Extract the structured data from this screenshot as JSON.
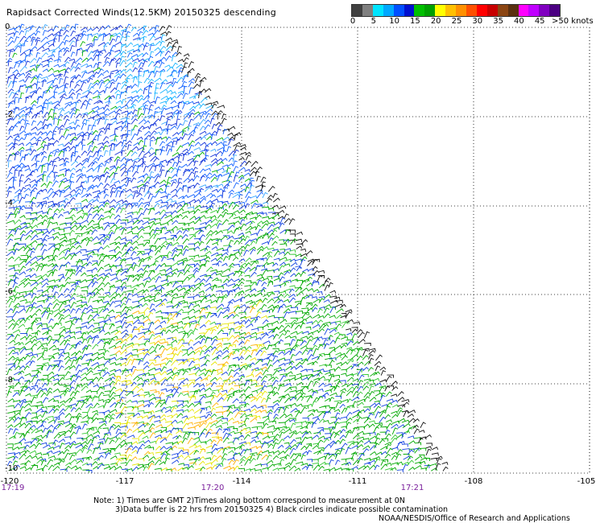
{
  "title": "Rapidsact Corrected Winds(12.5KM) 20150325 descending",
  "legend": {
    "colors": [
      "#404040",
      "#808080",
      "#00e5ff",
      "#00a8ff",
      "#0050ff",
      "#0010d0",
      "#00c000",
      "#00a000",
      "#ffff00",
      "#ffc000",
      "#ff9000",
      "#ff5000",
      "#ff0000",
      "#c80000",
      "#8b4513",
      "#5a3010",
      "#ff00ff",
      "#c000ff",
      "#8000c0",
      "#4b0082"
    ],
    "ticks": [
      "0",
      "5",
      "10",
      "15",
      "20",
      "25",
      "30",
      "35",
      "40",
      "45"
    ],
    "units_label": ">50 knots"
  },
  "lat_labels": [
    "0",
    "-2",
    "-4",
    "-6",
    "-8",
    "-10"
  ],
  "lon_labels": [
    "-120",
    "-117",
    "-114",
    "-111",
    "-108",
    "-105"
  ],
  "time_labels": [
    "17:19",
    "17:20",
    "17:21"
  ],
  "notes": {
    "line1": "Note: 1) Times are GMT 2)Times along bottom correspond to measurement at 0N",
    "line2": "3)Data buffer is 22 hrs from 20150325 4) Black circles indicate possible contamination",
    "line3": "NOAA/NESDIS/Office of Research and Applications"
  }
}
